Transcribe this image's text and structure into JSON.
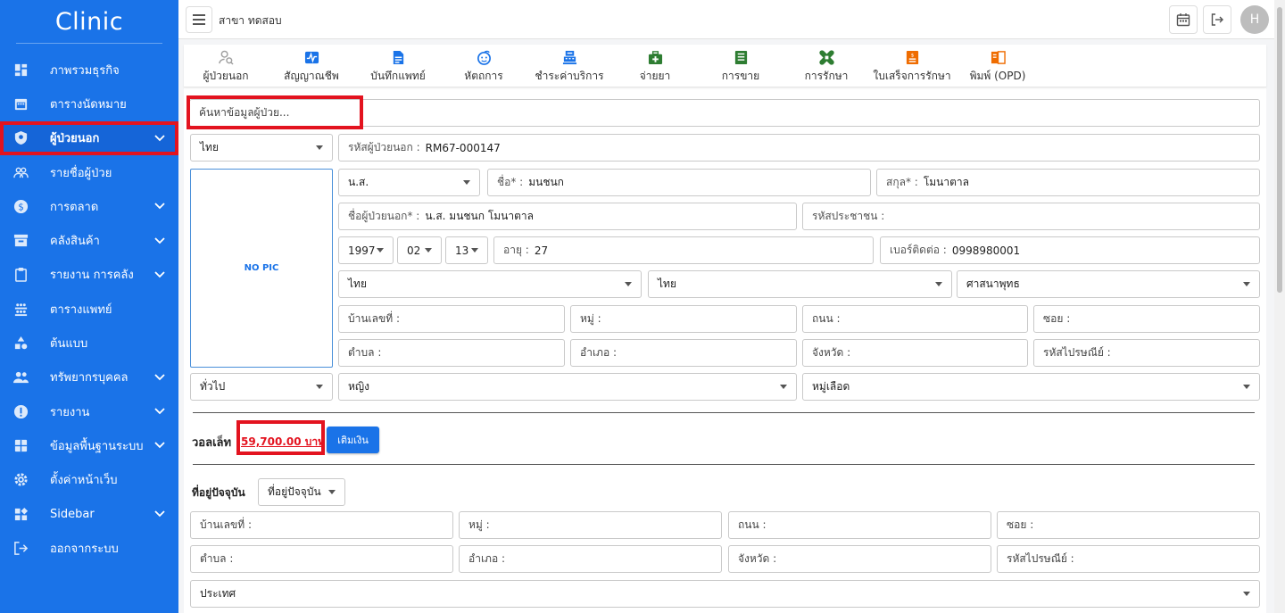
{
  "app": {
    "title": "Clinic",
    "branch": "สาขา ทดสอบ",
    "avatar_initial": "H"
  },
  "sidebar": {
    "items": [
      {
        "label": "ภาพรวมธุรกิจ",
        "icon": "dashboard-icon",
        "has_chevron": false
      },
      {
        "label": "ตารางนัดหมาย",
        "icon": "calendar-icon",
        "has_chevron": false
      },
      {
        "label": "ผู้ป่วยนอก",
        "icon": "shield-icon",
        "has_chevron": true,
        "active": true
      },
      {
        "label": "รายชื่อผู้ป่วย",
        "icon": "group-icon",
        "has_chevron": false
      },
      {
        "label": "การตลาด",
        "icon": "dollar-icon",
        "has_chevron": true
      },
      {
        "label": "คลังสินค้า",
        "icon": "archive-icon",
        "has_chevron": true
      },
      {
        "label": "รายงาน การคลัง",
        "icon": "clipboard-icon",
        "has_chevron": true
      },
      {
        "label": "ตารางแพทย์",
        "icon": "people-grid-icon",
        "has_chevron": false
      },
      {
        "label": "ต้นแบบ",
        "icon": "shapes-icon",
        "has_chevron": false
      },
      {
        "label": "ทรัพยากรบุคคล",
        "icon": "people-icon",
        "has_chevron": true
      },
      {
        "label": "รายงาน",
        "icon": "alert-icon",
        "has_chevron": true
      },
      {
        "label": "ข้อมูลพื้นฐานระบบ",
        "icon": "grid-plus-icon",
        "has_chevron": true
      },
      {
        "label": "ตั้งค่าหน้าเว็บ",
        "icon": "gear-icon",
        "has_chevron": false
      },
      {
        "label": "Sidebar",
        "icon": "widgets-icon",
        "has_chevron": true
      },
      {
        "label": "ออกจากระบบ",
        "icon": "logout-icon",
        "has_chevron": false
      }
    ]
  },
  "tabs": [
    {
      "label": "ผู้ป่วยนอก",
      "icon": "patient-search-icon",
      "color": "#9e9e9e"
    },
    {
      "label": "สัญญาณชีพ",
      "icon": "vitals-icon",
      "color": "#1a73e8"
    },
    {
      "label": "บันทึกแพทย์",
      "icon": "doc-note-icon",
      "color": "#1a73e8"
    },
    {
      "label": "หัตถการ",
      "icon": "face-icon",
      "color": "#1a73e8"
    },
    {
      "label": "ชำระค่าบริการ",
      "icon": "cashier-icon",
      "color": "#1a73e8"
    },
    {
      "label": "จ่ายยา",
      "icon": "medkit-icon",
      "color": "#2e7d32"
    },
    {
      "label": "การขาย",
      "icon": "receipt-icon",
      "color": "#2e7d32"
    },
    {
      "label": "การรักษา",
      "icon": "bandage-icon",
      "color": "#2e7d32"
    },
    {
      "label": "ใบเสร็จการรักษา",
      "icon": "invoice-icon",
      "color": "#ef6c00"
    },
    {
      "label": "พิมพ์ (OPD)",
      "icon": "book-icon",
      "color": "#ef6c00"
    }
  ],
  "form": {
    "search_placeholder": "ค้นหาข้อมูลผู้ป่วย...",
    "nationality": "ไทย",
    "patient_code_caption": "รหัสผู้ป่วยนอก :",
    "patient_code": "RM67-000147",
    "no_pic": "NO PIC",
    "prefix": "น.ส.",
    "first_name_caption": "ชื่อ* :",
    "first_name": "มนชนก",
    "last_name_caption": "สกุล* :",
    "last_name": "โมนาตาล",
    "full_name_caption": "ชื่อผู้ป่วยนอก* :",
    "full_name": "น.ส. มนชนก โมนาตาล",
    "id_card_caption": "รหัสประชาชน :",
    "birth_year": "1997",
    "birth_month": "02",
    "birth_day": "13",
    "age_caption": "อายุ :",
    "age": "27",
    "phone_caption": "เบอร์ติดต่อ :",
    "phone": "0998980001",
    "ethnicity": "ไทย",
    "nation": "ไทย",
    "religion": "ศาสนาพุทธ",
    "house_no": "บ้านเลขที่ :",
    "moo": "หมู่ :",
    "road": "ถนน :",
    "soi": "ซอย :",
    "subdistrict": "ตำบล :",
    "district": "อำเภอ :",
    "province": "จังหวัด :",
    "postcode": "รหัสไปรษณีย์ :",
    "patient_type": "ทั่วไป",
    "gender": "หญิง",
    "blood_group": "หมู่เลือด",
    "wallet_label": "วอลเล็ท",
    "wallet_amount": "59,700.00 บาท",
    "topup_label": "เติมเงิน",
    "current_address_label": "ที่อยู่ปัจจุบัน",
    "current_address_select": "ที่อยู่ปัจจุบัน",
    "country": "ประเทศ"
  },
  "colors": {
    "sidebar": "#1a73e8",
    "highlight": "#e3131f",
    "accent": "#1a73e8"
  }
}
